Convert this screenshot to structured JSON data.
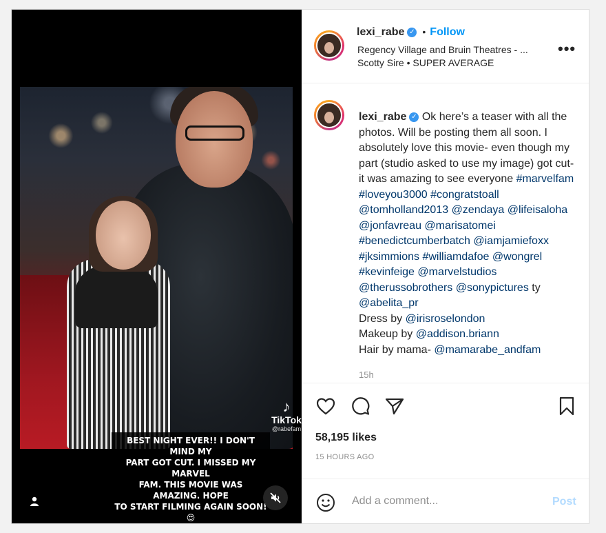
{
  "media": {
    "overlay_lines": [
      "BEST NIGHT EVER!! I DON'T MIND MY",
      "PART GOT CUT. I MISSED MY MARVEL",
      "FAM. THIS MOVIE WAS AMAZING. HOPE",
      "TO START FILMING AGAIN SOON!😍"
    ],
    "tiktok_label": "TikTok",
    "tiktok_handle": "@rabefam",
    "user_tag_icon": "person-icon",
    "mute_icon": "speaker-muted-icon"
  },
  "header": {
    "username": "lexi_rabe",
    "verified_icon": "verified-badge-icon",
    "separator": "•",
    "follow_label": "Follow",
    "location": "Regency Village and Bruin Theatres - ...",
    "audio": "Scotty Sire • SUPER AVERAGE",
    "more_label": "•••"
  },
  "caption": {
    "username": "lexi_rabe",
    "segments": [
      {
        "text": "Ok here’s a teaser with all the photos. Will be posting them all soon. I absolutely love this movie- even though my part (studio asked to use my image) got cut- it was amazing to see everyone ",
        "tag": false
      },
      {
        "text": "#marvelfam",
        "tag": true
      },
      {
        "text": " ",
        "tag": false
      },
      {
        "text": "#loveyou3000",
        "tag": true
      },
      {
        "text": " ",
        "tag": false
      },
      {
        "text": "#congratstoall",
        "tag": true
      },
      {
        "text": " ",
        "tag": false
      },
      {
        "text": "@tomholland2013",
        "tag": true
      },
      {
        "text": " ",
        "tag": false
      },
      {
        "text": "@zendaya",
        "tag": true
      },
      {
        "text": " ",
        "tag": false
      },
      {
        "text": "@lifeisaloha",
        "tag": true
      },
      {
        "text": " ",
        "tag": false
      },
      {
        "text": "@jonfavreau",
        "tag": true
      },
      {
        "text": " ",
        "tag": false
      },
      {
        "text": "@marisatomei",
        "tag": true
      },
      {
        "text": " ",
        "tag": false
      },
      {
        "text": "#benedictcumberbatch",
        "tag": true
      },
      {
        "text": " ",
        "tag": false
      },
      {
        "text": "@iamjamiefoxx",
        "tag": true
      },
      {
        "text": " ",
        "tag": false
      },
      {
        "text": "#jksimmions",
        "tag": true
      },
      {
        "text": " ",
        "tag": false
      },
      {
        "text": "#williamdafoe",
        "tag": true
      },
      {
        "text": " ",
        "tag": false
      },
      {
        "text": "@wongrel",
        "tag": true
      },
      {
        "text": " ",
        "tag": false
      },
      {
        "text": "#kevinfeige",
        "tag": true
      },
      {
        "text": " ",
        "tag": false
      },
      {
        "text": "@marvelstudios",
        "tag": true
      },
      {
        "text": " ",
        "tag": false
      },
      {
        "text": "@therussobrothers",
        "tag": true
      },
      {
        "text": " ",
        "tag": false
      },
      {
        "text": "@sonypictures",
        "tag": true
      },
      {
        "text": " ty ",
        "tag": false
      },
      {
        "text": "@abelita_pr",
        "tag": true
      },
      {
        "text": "\nDress by ",
        "tag": false
      },
      {
        "text": "@irisroselondon",
        "tag": true
      },
      {
        "text": "\nMakeup by ",
        "tag": false
      },
      {
        "text": "@addison.briann",
        "tag": true
      },
      {
        "text": "\nHair by mama- ",
        "tag": false
      },
      {
        "text": "@mamarabe_andfam",
        "tag": true
      }
    ],
    "time_ago": "15h"
  },
  "actions": {
    "like_icon": "heart-icon",
    "comment_icon": "comment-bubble-icon",
    "share_icon": "paper-plane-icon",
    "save_icon": "bookmark-icon"
  },
  "likes": "58,195 likes",
  "posted": "15 HOURS AGO",
  "comment_box": {
    "emoji_icon": "smiley-icon",
    "placeholder": "Add a comment...",
    "post_label": "Post"
  },
  "colors": {
    "link": "#00376b",
    "follow": "#0095f6",
    "post_disabled": "#b3dbff",
    "verified": "#3897f0"
  }
}
